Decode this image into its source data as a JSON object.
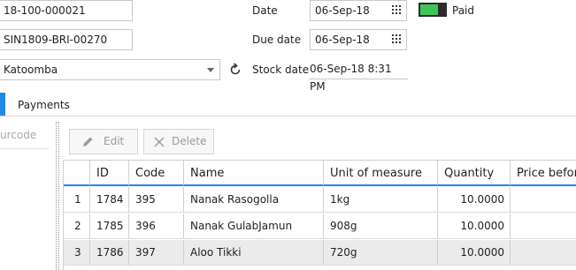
{
  "header": {
    "invoice_number": "18-100-000021",
    "supplier_invoice": "SIN1809-BRI-00270",
    "location": "Katoomba",
    "date_label": "Date",
    "date_value": "06-Sep-18",
    "due_date_label": "Due date",
    "due_date_value": "06-Sep-18",
    "stock_date_label": "Stock date",
    "stock_date_value": "06-Sep-18 8:31 PM",
    "paid_label": "Paid",
    "paid": true
  },
  "tabs": [
    {
      "label": "Payments"
    }
  ],
  "barcode": {
    "placeholder": "urcode"
  },
  "toolbar": {
    "edit_label": "Edit",
    "delete_label": "Delete"
  },
  "grid": {
    "columns": [
      "ID",
      "Code",
      "Name",
      "Unit of measure",
      "Quantity",
      "Price before"
    ],
    "rows": [
      {
        "index": "1",
        "id": "1784",
        "code": "395",
        "name": "Nanak Rasogolla",
        "uom": "1kg",
        "quantity": "10.0000",
        "price": ""
      },
      {
        "index": "2",
        "id": "1785",
        "code": "396",
        "name": "Nanak GulabJamun",
        "uom": "908g",
        "quantity": "10.0000",
        "price": ""
      },
      {
        "index": "3",
        "id": "1786",
        "code": "397",
        "name": "Aloo Tikki",
        "uom": "720g",
        "quantity": "10.0000",
        "price": ""
      }
    ]
  },
  "colors": {
    "accent": "#1e88e5",
    "toggle_on": "#3fc45a",
    "selected_row": "#ebebeb"
  }
}
